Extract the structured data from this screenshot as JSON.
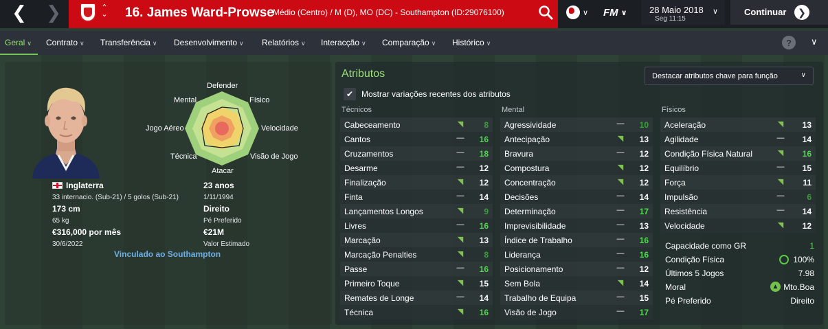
{
  "topbar": {
    "back_icon": "chevron-left-icon",
    "forward_icon": "chevron-right-icon",
    "player_title": "16. James Ward-Prowse",
    "player_positions": "Médio (Centro) / M (D), MO (DC) - Southampton (ID:29076100)",
    "fm_label": "FM",
    "date": "28 Maio 2018",
    "time": "Seg 11:15",
    "continue_label": "Continuar",
    "colors": {
      "strip": "#cc0a13",
      "bar": "#1b1e23"
    }
  },
  "menu": {
    "items": [
      "Geral",
      "Contrato",
      "Transferência",
      "Desenvolvimento",
      "Relatórios",
      "Interacção",
      "Comparação",
      "Histórico"
    ],
    "active": "Geral",
    "help_label": "?"
  },
  "profile": {
    "radar_labels": {
      "top": "Defender",
      "top_right": "Físico",
      "right": "Velocidade",
      "bottom_right": "Visão de Jogo",
      "bottom": "Atacar",
      "bottom_left": "Técnica",
      "left": "Jogo Aéreo",
      "top_left": "Mental"
    },
    "nationality": "Inglaterra",
    "caps": "33 internacio. (Sub-21) / 5 golos (Sub-21)",
    "age": "23 anos",
    "birth_date": "1/11/1994",
    "height": "173 cm",
    "weight": "65 kg",
    "preferred_foot": "Direito",
    "preferred_foot_label": "Pé Preferido",
    "wage": "€316,000 por mês",
    "contract_end": "30/6/2022",
    "value": "€21M",
    "value_label": "Valor Estimado",
    "club_link": "Vinculado ao Southampton"
  },
  "attributes": {
    "title": "Atributos",
    "highlight_dropdown": "Destacar atributos chave para função",
    "show_changes_label": "Mostrar variações recentes dos atributos",
    "show_changes_checked": true,
    "columns": [
      {
        "heading": "Técnicos",
        "rows": [
          {
            "name": "Cabeceamento",
            "trend": "up",
            "value": "8",
            "tone": "dim"
          },
          {
            "name": "Cantos",
            "trend": "flat",
            "value": "16",
            "tone": "green"
          },
          {
            "name": "Cruzamentos",
            "trend": "flat",
            "value": "18",
            "tone": "green"
          },
          {
            "name": "Desarme",
            "trend": "flat",
            "value": "12",
            "tone": "white"
          },
          {
            "name": "Finalização",
            "trend": "up",
            "value": "12",
            "tone": "white"
          },
          {
            "name": "Finta",
            "trend": "flat",
            "value": "14",
            "tone": "white"
          },
          {
            "name": "Lançamentos Longos",
            "trend": "up",
            "value": "9",
            "tone": "dim"
          },
          {
            "name": "Livres",
            "trend": "flat",
            "value": "16",
            "tone": "green"
          },
          {
            "name": "Marcação",
            "trend": "up",
            "value": "13",
            "tone": "white"
          },
          {
            "name": "Marcação Penalties",
            "trend": "up",
            "value": "8",
            "tone": "dim"
          },
          {
            "name": "Passe",
            "trend": "flat",
            "value": "16",
            "tone": "green"
          },
          {
            "name": "Primeiro Toque",
            "trend": "up",
            "value": "15",
            "tone": "white"
          },
          {
            "name": "Remates de Longe",
            "trend": "flat",
            "value": "14",
            "tone": "white"
          },
          {
            "name": "Técnica",
            "trend": "up",
            "value": "16",
            "tone": "green"
          }
        ]
      },
      {
        "heading": "Mental",
        "rows": [
          {
            "name": "Agressividade",
            "trend": "flat",
            "value": "10",
            "tone": "dim"
          },
          {
            "name": "Antecipação",
            "trend": "up",
            "value": "13",
            "tone": "white"
          },
          {
            "name": "Bravura",
            "trend": "flat",
            "value": "12",
            "tone": "white"
          },
          {
            "name": "Compostura",
            "trend": "up",
            "value": "12",
            "tone": "white"
          },
          {
            "name": "Concentração",
            "trend": "up",
            "value": "12",
            "tone": "white"
          },
          {
            "name": "Decisões",
            "trend": "flat",
            "value": "14",
            "tone": "white"
          },
          {
            "name": "Determinação",
            "trend": "flat",
            "value": "17",
            "tone": "green"
          },
          {
            "name": "Imprevisibilidade",
            "trend": "flat",
            "value": "13",
            "tone": "white"
          },
          {
            "name": "Índice de Trabalho",
            "trend": "flat",
            "value": "16",
            "tone": "green"
          },
          {
            "name": "Liderança",
            "trend": "flat",
            "value": "16",
            "tone": "green"
          },
          {
            "name": "Posicionamento",
            "trend": "flat",
            "value": "12",
            "tone": "white"
          },
          {
            "name": "Sem Bola",
            "trend": "up",
            "value": "14",
            "tone": "white"
          },
          {
            "name": "Trabalho de Equipa",
            "trend": "flat",
            "value": "15",
            "tone": "white"
          },
          {
            "name": "Visão de Jogo",
            "trend": "flat",
            "value": "17",
            "tone": "green"
          }
        ]
      },
      {
        "heading": "Físicos",
        "rows": [
          {
            "name": "Aceleração",
            "trend": "up",
            "value": "13",
            "tone": "white"
          },
          {
            "name": "Agilidade",
            "trend": "flat",
            "value": "14",
            "tone": "white"
          },
          {
            "name": "Condição Física Natural",
            "trend": "up",
            "value": "16",
            "tone": "green"
          },
          {
            "name": "Equilíbrio",
            "trend": "flat",
            "value": "15",
            "tone": "white"
          },
          {
            "name": "Força",
            "trend": "up",
            "value": "11",
            "tone": "white"
          },
          {
            "name": "Impulsão",
            "trend": "flat",
            "value": "6",
            "tone": "dim"
          },
          {
            "name": "Resistência",
            "trend": "flat",
            "value": "14",
            "tone": "white"
          },
          {
            "name": "Velocidade",
            "trend": "up",
            "value": "12",
            "tone": "white"
          }
        ]
      }
    ],
    "extra": {
      "gk_ability_label": "Capacidade como GR",
      "gk_ability_value": "1",
      "condition_label": "Condição Física",
      "condition_value": "100%",
      "last5_label": "Últimos 5 Jogos",
      "last5_value": "7.98",
      "morale_label": "Moral",
      "morale_value": "Mto.Boa",
      "foot_label": "Pé Preferido",
      "foot_value": "Direito"
    }
  }
}
